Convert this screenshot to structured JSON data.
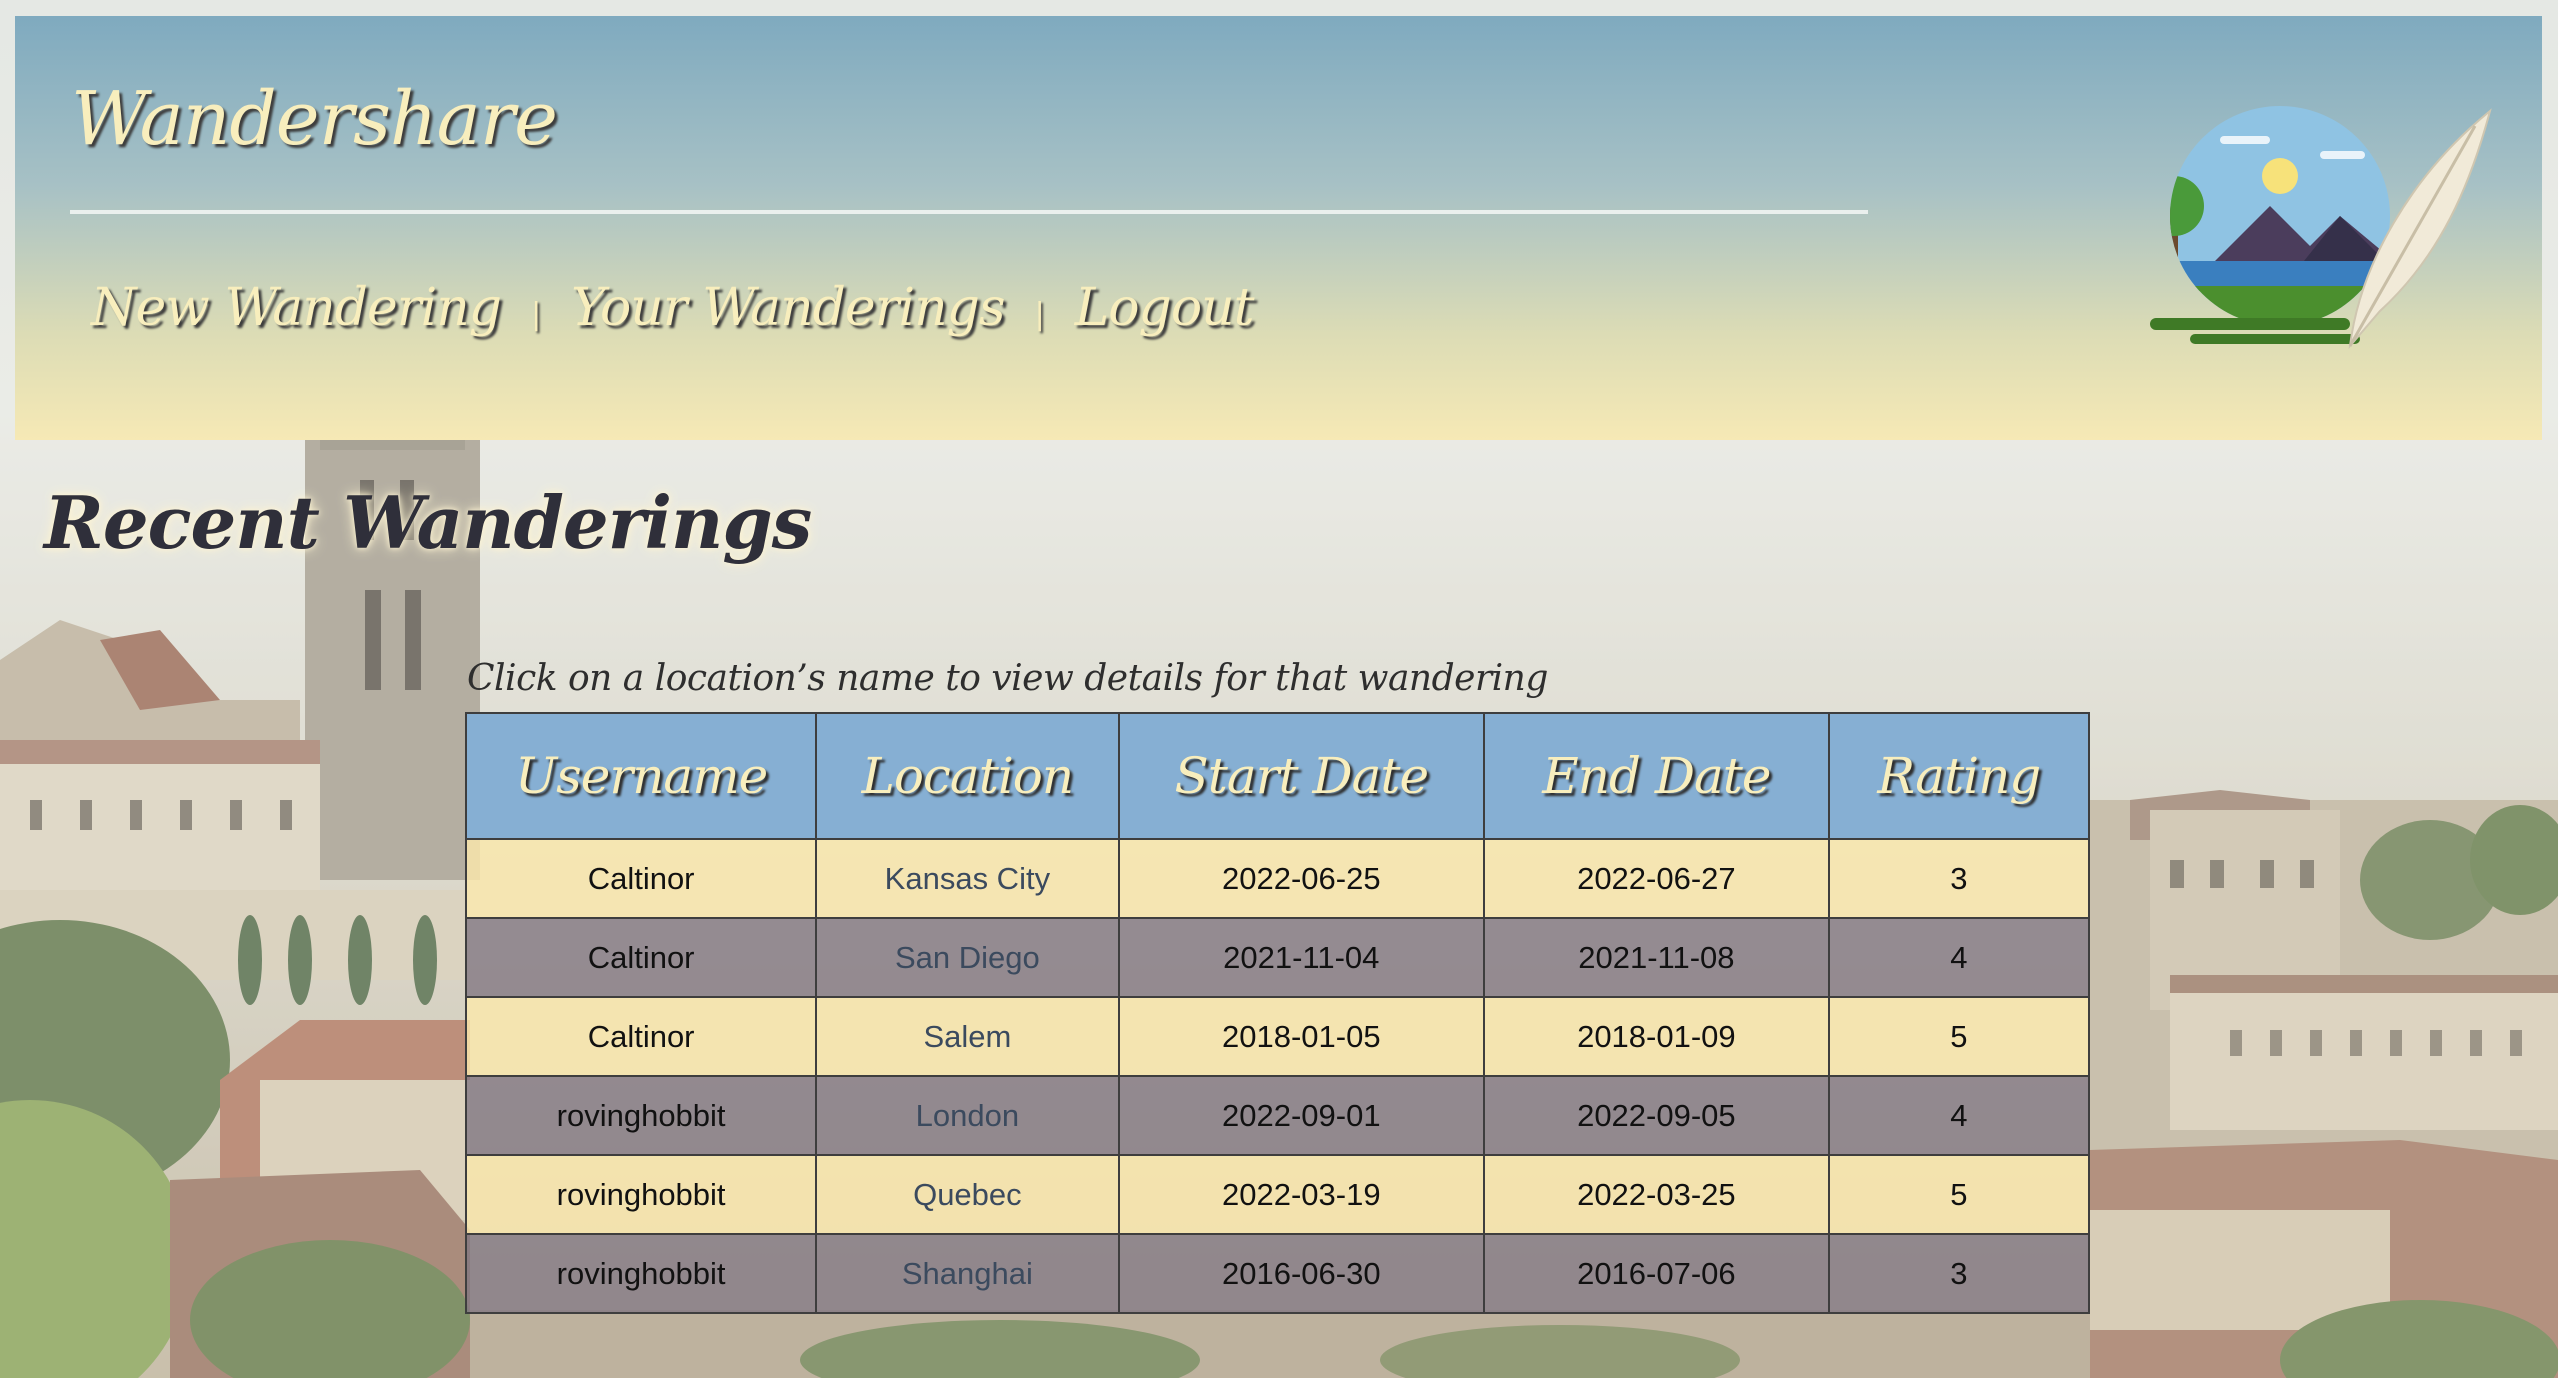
{
  "header": {
    "site_title": "Wandershare",
    "nav": [
      {
        "label": "New Wandering"
      },
      {
        "label": "Your Wanderings"
      },
      {
        "label": "Logout"
      }
    ],
    "nav_separator": "|",
    "logo_icon": "landscape-quill-logo-icon"
  },
  "main": {
    "page_title": "Recent Wanderings",
    "hint": "Click on a location’s name to view details for that wandering",
    "table": {
      "columns": [
        "Username",
        "Location",
        "Start Date",
        "End Date",
        "Rating"
      ],
      "rows": [
        {
          "username": "Caltinor",
          "location": "Kansas City",
          "start": "2022-06-25",
          "end": "2022-06-27",
          "rating": "3"
        },
        {
          "username": "Caltinor",
          "location": "San Diego",
          "start": "2021-11-04",
          "end": "2021-11-08",
          "rating": "4"
        },
        {
          "username": "Caltinor",
          "location": "Salem",
          "start": "2018-01-05",
          "end": "2018-01-09",
          "rating": "5"
        },
        {
          "username": "rovinghobbit",
          "location": "London",
          "start": "2022-09-01",
          "end": "2022-09-05",
          "rating": "4"
        },
        {
          "username": "rovinghobbit",
          "location": "Quebec",
          "start": "2022-03-19",
          "end": "2022-03-25",
          "rating": "5"
        },
        {
          "username": "rovinghobbit",
          "location": "Shanghai",
          "start": "2016-06-30",
          "end": "2016-07-06",
          "rating": "3"
        }
      ]
    }
  },
  "colors": {
    "header_top": "#7faabf",
    "header_bottom": "#f6e9b5",
    "title_text": "#f8eebd",
    "table_header": "#86afd3",
    "row_light": "#fae8ac",
    "row_dark": "#807682"
  }
}
